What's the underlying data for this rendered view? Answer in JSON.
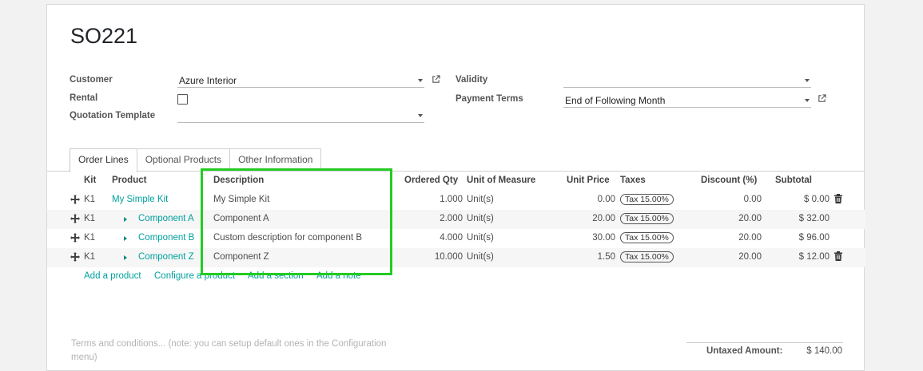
{
  "record": {
    "title": "SO221"
  },
  "form": {
    "customer_label": "Customer",
    "customer_value": "Azure Interior",
    "rental_label": "Rental",
    "template_label": "Quotation Template",
    "template_value": "",
    "validity_label": "Validity",
    "validity_value": "",
    "payment_terms_label": "Payment Terms",
    "payment_terms_value": "End of Following Month"
  },
  "tabs": [
    {
      "label": "Order Lines",
      "active": true
    },
    {
      "label": "Optional Products",
      "active": false
    },
    {
      "label": "Other Information",
      "active": false
    }
  ],
  "table": {
    "headers": {
      "kit": "Kit",
      "product": "Product",
      "description": "Description",
      "ordered_qty": "Ordered Qty",
      "uom": "Unit of Measure",
      "unit_price": "Unit Price",
      "taxes": "Taxes",
      "discount": "Discount (%)",
      "subtotal": "Subtotal"
    },
    "rows": [
      {
        "kit": "K1",
        "product": "My Simple Kit",
        "description": "My Simple Kit",
        "qty": "1.000",
        "uom": "Unit(s)",
        "price": "0.00",
        "tax": "Tax 15.00%",
        "discount": "0.00",
        "subtotal": "$ 0.00"
      },
      {
        "kit": "K1",
        "product": "Component A",
        "description": "Component A",
        "qty": "2.000",
        "uom": "Unit(s)",
        "price": "20.00",
        "tax": "Tax 15.00%",
        "discount": "20.00",
        "subtotal": "$ 32.00"
      },
      {
        "kit": "K1",
        "product": "Component B",
        "description": "Custom description for component B",
        "qty": "4.000",
        "uom": "Unit(s)",
        "price": "30.00",
        "tax": "Tax 15.00%",
        "discount": "20.00",
        "subtotal": "$ 96.00"
      },
      {
        "kit": "K1",
        "product": "Component Z",
        "description": "Component Z",
        "qty": "10.000",
        "uom": "Unit(s)",
        "price": "1.50",
        "tax": "Tax 15.00%",
        "discount": "20.00",
        "subtotal": "$ 12.00"
      }
    ]
  },
  "actions": {
    "add_product": "Add a product",
    "configure_product": "Configure a product",
    "add_section": "Add a section",
    "add_note": "Add a note"
  },
  "footer": {
    "terms_placeholder": "Terms and conditions... (note: you can setup default ones in the Configuration menu)",
    "untaxed_label": "Untaxed Amount:",
    "untaxed_value": "$ 140.00"
  },
  "colors": {
    "accent": "#00a09d",
    "highlight": "#22cc22"
  }
}
